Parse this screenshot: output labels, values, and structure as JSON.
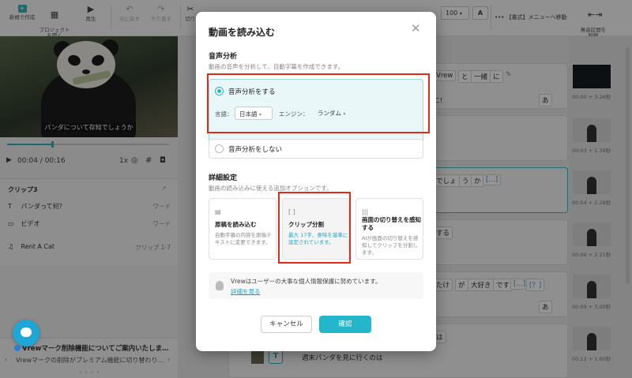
{
  "toolbar": {
    "new_label": "新規で作成",
    "open_label": "プロジェクト\nを開く",
    "play_label": "再生",
    "undo_label": "元に戻す",
    "redo_label": "やり直す",
    "cut_label": "切り",
    "font_size": "100",
    "format_menu_label": "【書式】メニューへ移動",
    "silence_label": "無音区間を\n短縮"
  },
  "player": {
    "subtitle": "パンダについて存知でしょうか",
    "time": "00:04 / 00:16",
    "speed": "1x",
    "progress_fraction": 0.28
  },
  "clip_panel": {
    "title": "クリップ3",
    "rows": [
      {
        "icon": "text-icon",
        "label": "パンダって何？",
        "tag": "ワード"
      },
      {
        "icon": "video-icon",
        "label": "ビデオ",
        "tag": "ワード"
      },
      {
        "icon": "music-icon",
        "label": "Rent A Cat",
        "tag": "クリップ 1-7"
      }
    ]
  },
  "notice": {
    "title": "Vrewマーク削除機能についてご案内いたしま…",
    "subtitle": "Vrewマークの削除がプレミアム機能に切り替わり…"
  },
  "editor": {
    "chips_row1": [
      "Vrew",
      "と",
      "一緒",
      "に"
    ],
    "row1b": "に！",
    "row1b_chip": "あ",
    "chips_row3": [
      "でしょ",
      "う",
      "か",
      "[…]"
    ],
    "row4_text": "する",
    "chips_row6": [
      "たけ",
      "が",
      "大好き",
      "です",
      "[…]",
      "[？]"
    ],
    "row6_chip": "あ",
    "row7_text": "は",
    "row8_text": "週末パンダを見に行くのは"
  },
  "thumbs": [
    {
      "label": "00:00 + 3.26秒",
      "dark": true
    },
    {
      "label": "00:03 + 1.39秒",
      "dark": false
    },
    {
      "label": "00:04 + 2.28秒",
      "dark": false
    },
    {
      "label": "00:06 + 2.21秒",
      "dark": false
    },
    {
      "label": "00:09 + 3.00秒",
      "dark": false
    },
    {
      "label": "00:12 + 1.60秒",
      "dark": false
    }
  ],
  "modal": {
    "title": "動画を読み込む",
    "voice_section_title": "音声分析",
    "voice_section_desc": "動画の音声を分析して、自動字幕を作成できます。",
    "option_on_label": "音声分析をする",
    "language_label": "言語：",
    "language_value": "日本語",
    "engine_label": "エンジン：",
    "engine_value": "ランダム",
    "option_off_label": "音声分析をしない",
    "detail_section_title": "詳細設定",
    "detail_section_desc": "動画の読み込みに使える追加オプションです。",
    "cards": [
      {
        "icon": "document-icon",
        "title": "原稿を読み込む",
        "desc": "自動字幕の内容を原稿テキストに変更できます。",
        "selected": false
      },
      {
        "icon": "clip-split-icon",
        "title": "クリップ分割",
        "desc": "最大 17字、意味を基準に設定されています。",
        "selected": true
      },
      {
        "icon": "scene-detect-icon",
        "title": "画面の切り替えを感知する",
        "desc": "AIが画面の切り替えを感知してクリップを分割します。",
        "selected": false
      }
    ],
    "privacy_text": "Vrewはユーザーの大事な個人情報保護に努めています。",
    "privacy_link": "詳細を見る",
    "cancel_label": "キャンセル",
    "confirm_label": "確認"
  },
  "colors": {
    "accent": "#24b6cb",
    "highlight_red": "#e02a1a"
  }
}
